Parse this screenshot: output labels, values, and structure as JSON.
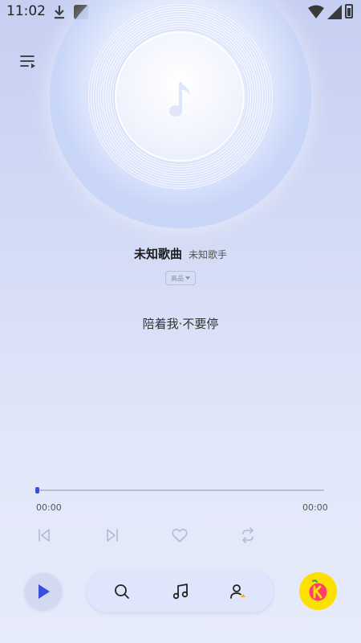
{
  "status_bar": {
    "time": "11:02",
    "icons": [
      "download-icon",
      "app-square-icon",
      "wifi-icon",
      "signal-icon",
      "battery-icon"
    ]
  },
  "player": {
    "song_title": "未知歌曲",
    "artist": "未知歌手",
    "quality_label": "高品",
    "lyric": "陪着我·不要停",
    "progress": 0,
    "time_current": "00:00",
    "time_total": "00:00"
  },
  "controls": {
    "icons": [
      "skip-previous-icon",
      "skip-next-icon",
      "heart-icon",
      "repeat-icon"
    ]
  },
  "bottom_nav": {
    "icons": [
      "play-icon",
      "search-icon",
      "music-note-icon",
      "user-icon",
      "k-logo-icon"
    ]
  },
  "colors": {
    "accent": "#3a4fd8",
    "background_top": "#c6cff2",
    "background_bottom": "#e6ebfb",
    "k_button": "#fce000"
  }
}
